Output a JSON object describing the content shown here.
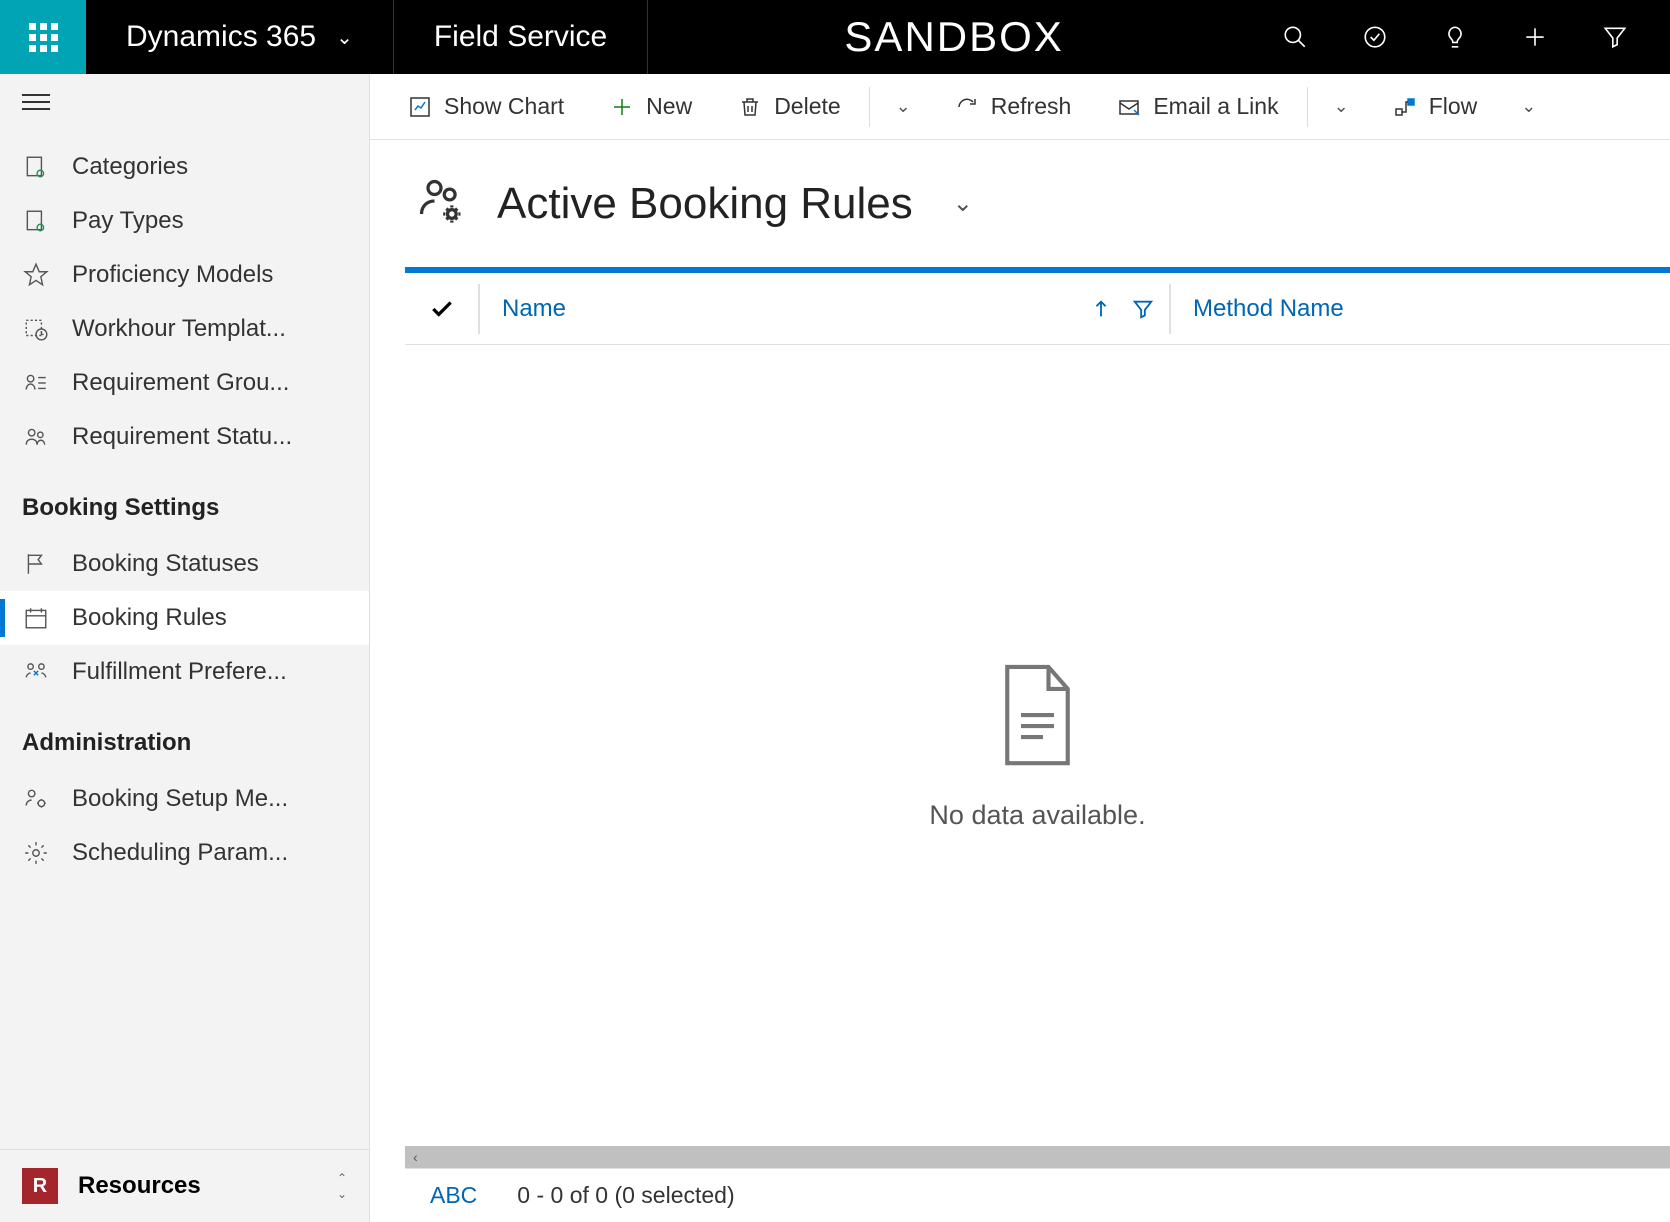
{
  "header": {
    "brand": "Dynamics 365",
    "module": "Field Service",
    "environment": "SANDBOX"
  },
  "commandBar": {
    "showChart": "Show Chart",
    "new": "New",
    "delete": "Delete",
    "refresh": "Refresh",
    "emailLink": "Email a Link",
    "flow": "Flow"
  },
  "sidebar": {
    "items1": [
      {
        "label": "Categories"
      },
      {
        "label": "Pay Types"
      },
      {
        "label": "Proficiency Models"
      },
      {
        "label": "Workhour Templat..."
      },
      {
        "label": "Requirement Grou..."
      },
      {
        "label": "Requirement Statu..."
      }
    ],
    "section2": "Booking Settings",
    "items2": [
      {
        "label": "Booking Statuses"
      },
      {
        "label": "Booking Rules"
      },
      {
        "label": "Fulfillment Prefere..."
      }
    ],
    "section3": "Administration",
    "items3": [
      {
        "label": "Booking Setup Me..."
      },
      {
        "label": "Scheduling Param..."
      }
    ],
    "areaBadge": "R",
    "areaLabel": "Resources"
  },
  "view": {
    "title": "Active Booking Rules"
  },
  "grid": {
    "columns": {
      "name": "Name",
      "methodName": "Method Name"
    },
    "emptyMessage": "No data available."
  },
  "footer": {
    "abc": "ABC",
    "count": "0 - 0 of 0 (0 selected)"
  }
}
